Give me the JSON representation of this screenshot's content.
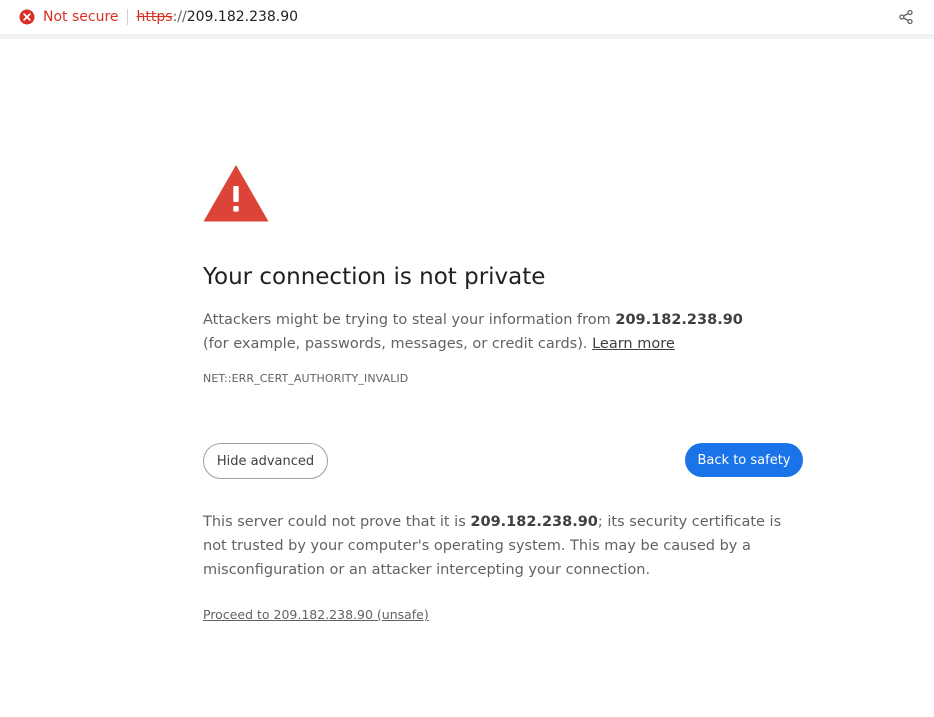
{
  "omnibox": {
    "security_label": "Not secure",
    "url_scheme": "https",
    "url_separator": "://",
    "url_host": "209.182.238.90",
    "security_icon": "error-circle-icon",
    "share_icon": "share-icon"
  },
  "interstitial": {
    "warning_icon": "warning-triangle-icon",
    "heading": "Your connection is not private",
    "message_part1": "Attackers might be trying to steal your information from ",
    "message_host": "209.182.238.90",
    "message_part2": " (for example, passwords, messages, or credit cards). ",
    "learn_more": "Learn more",
    "error_code": "NET::ERR_CERT_AUTHORITY_INVALID",
    "hide_advanced_label": "Hide advanced",
    "back_to_safety_label": "Back to safety",
    "details_part1": "This server could not prove that it is ",
    "details_host": "209.182.238.90",
    "details_part2": "; its security certificate is not trusted by your computer's operating system. This may be caused by a misconfiguration or an attacker intercepting your connection.",
    "proceed_link": "Proceed to 209.182.238.90 (unsafe)"
  },
  "colors": {
    "danger": "#d93025",
    "warning_icon": "#db4437",
    "primary_button": "#1a73e8"
  }
}
